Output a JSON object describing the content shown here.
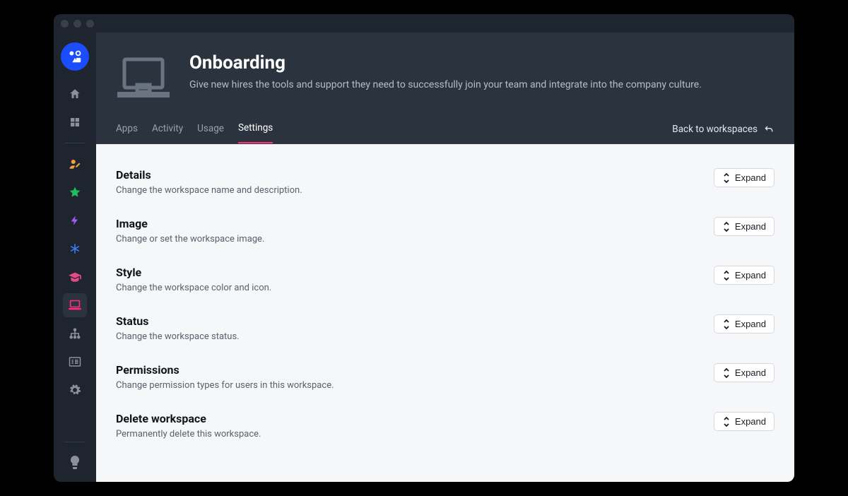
{
  "header": {
    "title": "Onboarding",
    "subtitle": "Give new hires the tools and support they need to successfully join your team and integrate into the company culture."
  },
  "tabs": {
    "apps": "Apps",
    "activity": "Activity",
    "usage": "Usage",
    "settings": "Settings"
  },
  "backlink": "Back to workspaces",
  "expand_label": "Expand",
  "sections": {
    "details": {
      "title": "Details",
      "desc": "Change the workspace name and description."
    },
    "image": {
      "title": "Image",
      "desc": "Change or set the workspace image."
    },
    "style": {
      "title": "Style",
      "desc": "Change the workspace color and icon."
    },
    "status": {
      "title": "Status",
      "desc": "Change the workspace status."
    },
    "permissions": {
      "title": "Permissions",
      "desc": "Change permission types for users in this workspace."
    },
    "delete": {
      "title": "Delete workspace",
      "desc": "Permanently delete this workspace."
    }
  },
  "sidebar_icons": {
    "home": "home-icon",
    "grid": "grid-icon",
    "user_edit": "user-edit-icon",
    "star": "star-icon",
    "bolt": "bolt-icon",
    "asterisk": "asterisk-icon",
    "grad": "graduation-cap-icon",
    "laptop": "laptop-icon",
    "branch": "sitemap-icon",
    "list": "list-icon",
    "gear": "gear-icon",
    "light": "lightbulb-icon"
  },
  "colors": {
    "accent": "#ff2d7a",
    "logo_bg": "#1b4dff",
    "star": "#1fbe5c",
    "user": "#f2a23b",
    "bolt": "#a15cff",
    "asterisk": "#3b82f6",
    "grad": "#e34b86"
  }
}
